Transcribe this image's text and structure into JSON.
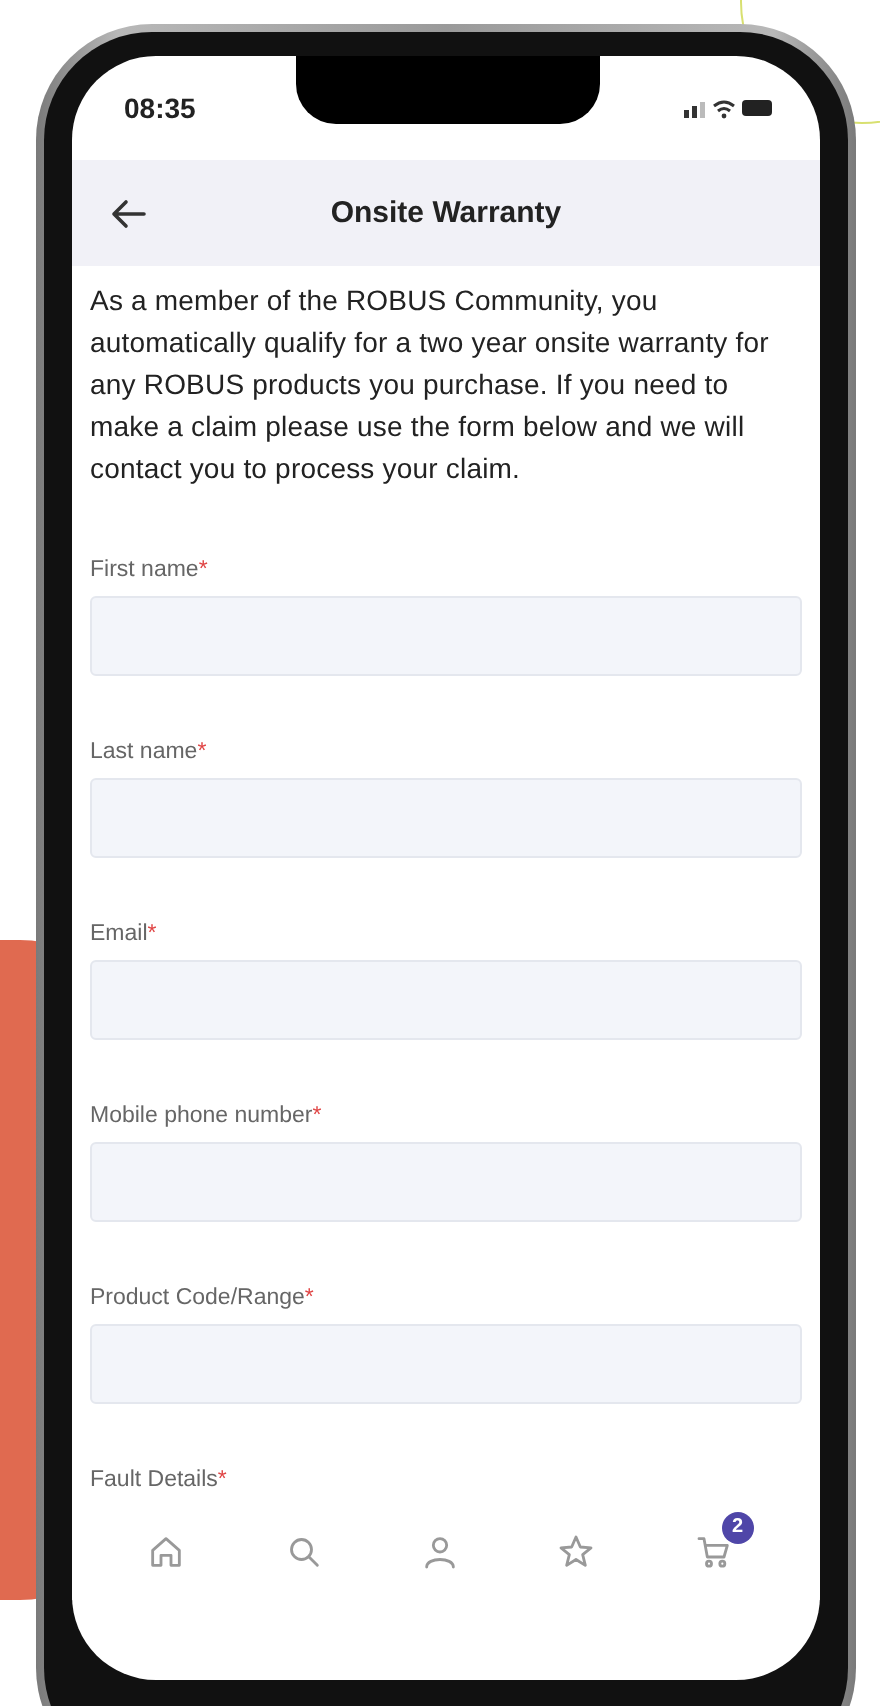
{
  "status_bar": {
    "time": "08:35"
  },
  "header": {
    "title": "Onsite Warranty"
  },
  "intro": "As a member of the ROBUS Community, you automatically qualify for a two year onsite warranty for any ROBUS products you purchase. If you need to make a claim please use the form below and we will contact you to process your claim.",
  "fields": [
    {
      "label": "First name",
      "required_mark": "*"
    },
    {
      "label": "Last name",
      "required_mark": "*"
    },
    {
      "label": "Email",
      "required_mark": "*"
    },
    {
      "label": "Mobile phone number",
      "required_mark": "*"
    },
    {
      "label": "Product Code/Range",
      "required_mark": "*"
    },
    {
      "label": "Fault Details",
      "required_mark": "*"
    }
  ],
  "tab_bar": [
    {
      "kind": "home"
    },
    {
      "kind": "search"
    },
    {
      "kind": "account"
    },
    {
      "kind": "favorites"
    },
    {
      "kind": "cart",
      "badge": "2"
    }
  ]
}
